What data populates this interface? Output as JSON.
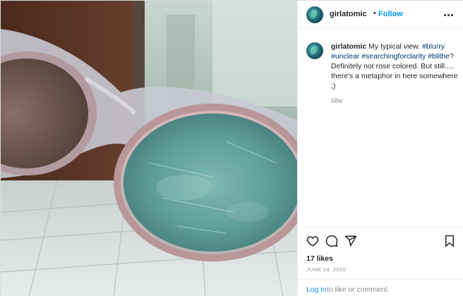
{
  "header": {
    "username": "girlatomic",
    "separator": "•",
    "follow_label": "Follow",
    "more_icon": "more-horizontal-icon"
  },
  "caption": {
    "username": "girlatomic",
    "text_1": "My typical view.",
    "hashtags_1": "#blurry",
    "hashtags_2": "#unclear #searchingforclarity #blithe",
    "text_2": "? Definitely not rose colored. But still.....",
    "text_3": "there's a metaphor in here somewhere ;)",
    "age": "68w"
  },
  "actions": {
    "like_icon": "heart-icon",
    "comment_icon": "comment-icon",
    "share_icon": "paper-plane-icon",
    "save_icon": "bookmark-icon"
  },
  "likes": "17 likes",
  "date": "JUNE 14, 2020",
  "comment_bar": {
    "login_label": "Log in",
    "rest_label": "to like or comment."
  },
  "colors": {
    "link_blue": "#0095f6",
    "hashtag_blue": "#00376b",
    "muted_gray": "#8e8e8e",
    "text": "#262626",
    "divider": "#efefef"
  }
}
